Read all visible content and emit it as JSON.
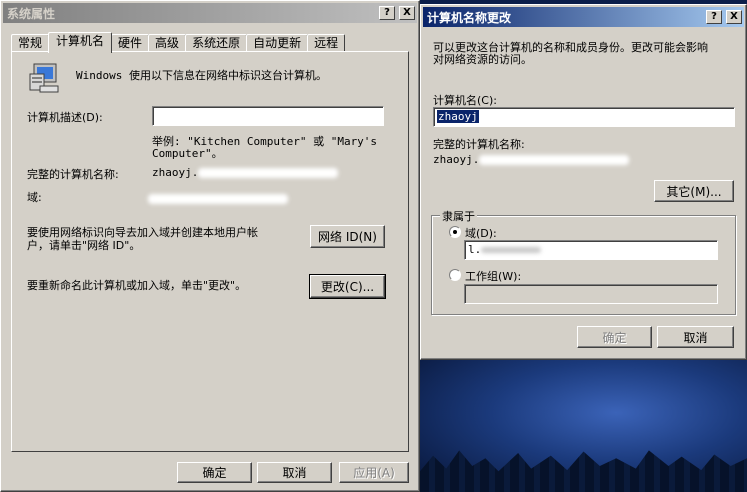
{
  "sysprops": {
    "title": "系统属性",
    "tabs": [
      "常规",
      "计算机名",
      "硬件",
      "高级",
      "系统还原",
      "自动更新",
      "远程"
    ],
    "intro_text": "Windows 使用以下信息在网络中标识这台计算机。",
    "desc_label": "计算机描述(D):",
    "desc_value": "",
    "example_line1": "举例: \"Kitchen Computer\" 或 \"Mary's",
    "example_line2": "Computer\"。",
    "fullname_label": "完整的计算机名称:",
    "fullname_value": "zhaoyj.",
    "domain_label": "域:",
    "netid_text_line1": "要使用网络标识向导去加入域并创建本地用户帐",
    "netid_text_line2": "户，请单击\"网络 ID\"。",
    "netid_button": "网络 ID(N)",
    "rename_text": "要重新命名此计算机或加入域，单击\"更改\"。",
    "change_button": "更改(C)...",
    "ok_button": "确定",
    "cancel_button": "取消",
    "apply_button": "应用(A)"
  },
  "rename_dialog": {
    "title": "计算机名称更改",
    "intro_line1": "可以更改这台计算机的名称和成员身份。更改可能会影响",
    "intro_line2": "对网络资源的访问。",
    "name_label": "计算机名(C):",
    "name_value": "zhaoyj",
    "fullname_label": "完整的计算机名称:",
    "fullname_value": "zhaoyj.",
    "more_button": "其它(M)...",
    "member_legend": "隶属于",
    "domain_radio_label": "域(D):",
    "domain_value": "l.",
    "workgroup_radio_label": "工作组(W):",
    "workgroup_value": "",
    "ok_button": "确定",
    "cancel_button": "取消"
  },
  "titlebar_buttons": {
    "help": "?",
    "close": "X"
  }
}
